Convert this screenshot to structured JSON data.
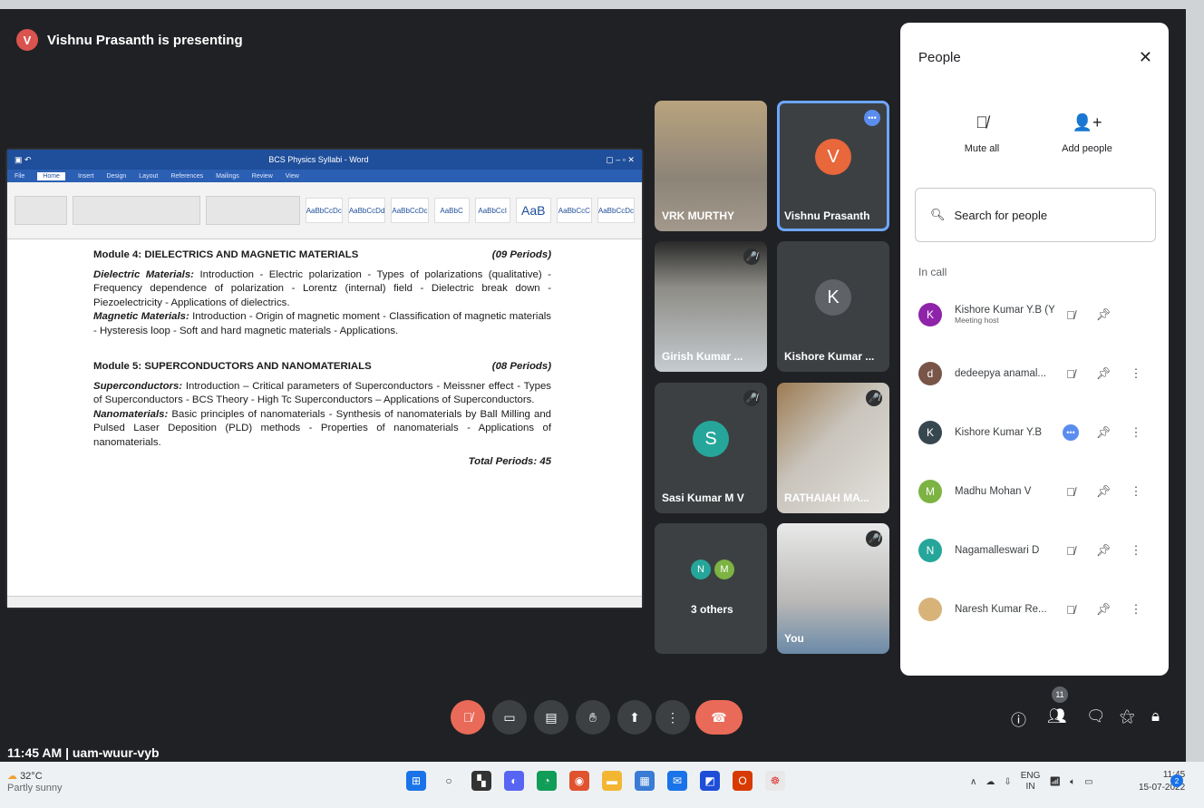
{
  "header": {
    "avatar_letter": "V",
    "presenting_text": "Vishnu Prasanth is presenting"
  },
  "word": {
    "title": "BCS Physics Syllabi - Word",
    "tabs": [
      "File",
      "Home",
      "Insert",
      "Design",
      "Layout",
      "References",
      "Mailings",
      "Review",
      "View"
    ],
    "styles": [
      "AaBbCcDc",
      "AaBbCcDd",
      "AaBbCcDc",
      "AaBbC",
      "AaBbCcI",
      "AaB",
      "AaBbCcC",
      "AaBbCcDc"
    ],
    "doc": {
      "module4_title": "Module 4:   DIELECTRICS AND MAGNETIC MATERIALS",
      "module4_periods": "(09 Periods)",
      "m4_p1_label": "Dielectric Materials:",
      "m4_p1_text": " Introduction - Electric polarization - Types of polarizations (qualitative) - Frequency dependence of polarization - Lorentz (internal) field - Dielectric break down - Piezoelectricity - Applications of dielectrics.",
      "m4_p2_label": "Magnetic Materials:",
      "m4_p2_text": " Introduction - Origin of magnetic moment - Classification of magnetic materials - Hysteresis loop - Soft and hard magnetic materials - Applications.",
      "module5_title": "Module 5:   SUPERCONDUCTORS AND NANOMATERIALS",
      "module5_periods": "(08 Periods)",
      "m5_p1_label": "Superconductors:",
      "m5_p1_text": " Introduction – Critical parameters of Superconductors - Meissner effect - Types of Superconductors - BCS Theory - High Tc Superconductors – Applications of Superconductors.",
      "m5_p2_label": "Nanomaterials:",
      "m5_p2_text": " Basic principles of nanomaterials - Synthesis of nanomaterials by Ball Milling and Pulsed Laser Deposition (PLD) methods - Properties of nanomaterials - Applications of nanomaterials.",
      "total": "Total Periods: 45"
    }
  },
  "tiles": {
    "t1_name": "VRK MURTHY",
    "t2_name": "Vishnu Prasanth",
    "t2_letter": "V",
    "t3_name": "Girish Kumar ...",
    "t4_name": "Kishore Kumar ...",
    "t4_letter": "K",
    "t5_name": "Sasi Kumar M V",
    "t5_letter": "S",
    "t6_name": "RATHAIAH MA...",
    "t7_name": "3 others",
    "t7_a": "N",
    "t7_b": "M",
    "t8_name": "You"
  },
  "people": {
    "title": "People",
    "mute_all": "Mute all",
    "add_people": "Add people",
    "search_placeholder": "Search for people",
    "in_call": "In call",
    "list": [
      {
        "letter": "K",
        "name": "Kishore Kumar Y.B (You)",
        "sub": "Meeting host",
        "color": "#8e24aa"
      },
      {
        "letter": "d",
        "name": "dedeepya anamal...",
        "color": "#795548"
      },
      {
        "letter": "K",
        "name": "Kishore Kumar Y.B",
        "color": "#37474f"
      },
      {
        "letter": "M",
        "name": "Madhu Mohan V",
        "color": "#7cb342"
      },
      {
        "letter": "N",
        "name": "Nagamalleswari D",
        "color": "#26a69a"
      },
      {
        "letter": "",
        "name": "Naresh Kumar Re...",
        "color": "#d7b37a"
      }
    ]
  },
  "bottom": {
    "time_code": "11:45 AM  |  uam-wuur-vyb",
    "participant_count": "11"
  },
  "taskbar": {
    "temp": "32°C",
    "weather": "Partly sunny",
    "lang1": "ENG",
    "lang2": "IN",
    "time": "11:45",
    "date": "15-07-2022",
    "notif": "2"
  }
}
